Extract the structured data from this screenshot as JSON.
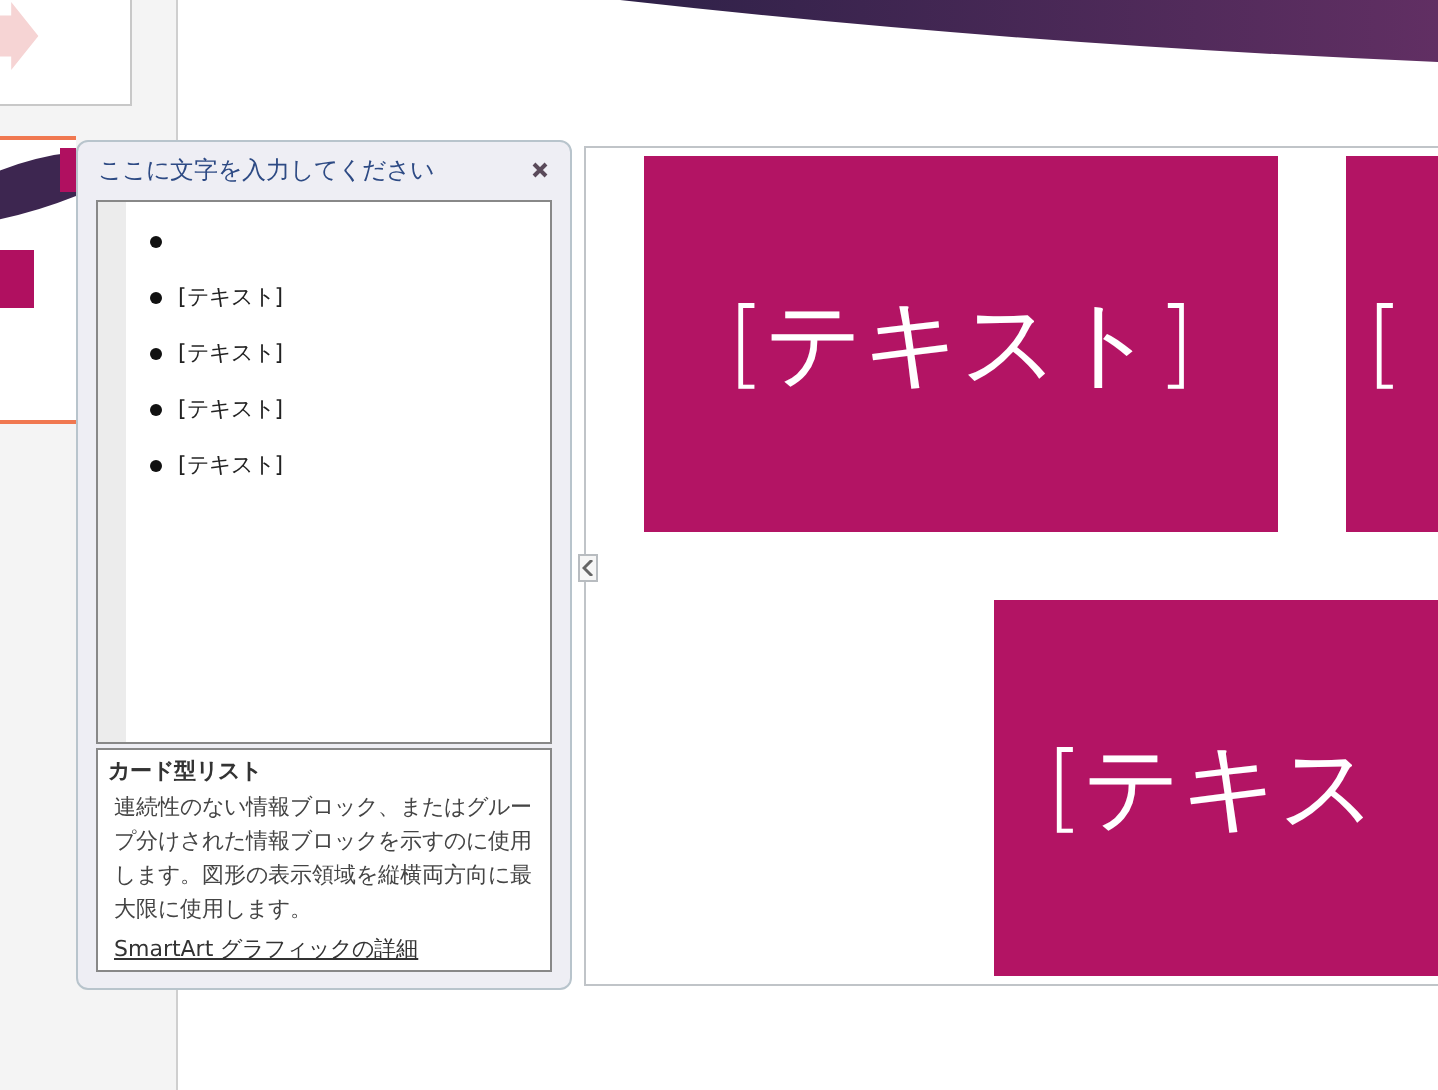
{
  "text_pane": {
    "title": "ここに文字を入力してください",
    "bullets": [
      {
        "kind": "blank"
      },
      {
        "kind": "text",
        "text": "[テキスト]"
      },
      {
        "kind": "text",
        "text": "[テキスト]"
      },
      {
        "kind": "text",
        "text": "[テキスト]"
      },
      {
        "kind": "text",
        "text": "[テキスト]"
      }
    ],
    "description": {
      "title": "カード型リスト",
      "body": "連続性のない情報ブロック、またはグループ分けされた情報ブロックを示すのに使用します。図形の表示領域を縦横両方向に最大限に使用します。",
      "link": "SmartArt グラフィックの詳細"
    }
  },
  "smartart": {
    "shapes": [
      {
        "text": "[テキスト]"
      },
      {
        "text": "["
      },
      {
        "text": "[テキス"
      }
    ]
  }
}
